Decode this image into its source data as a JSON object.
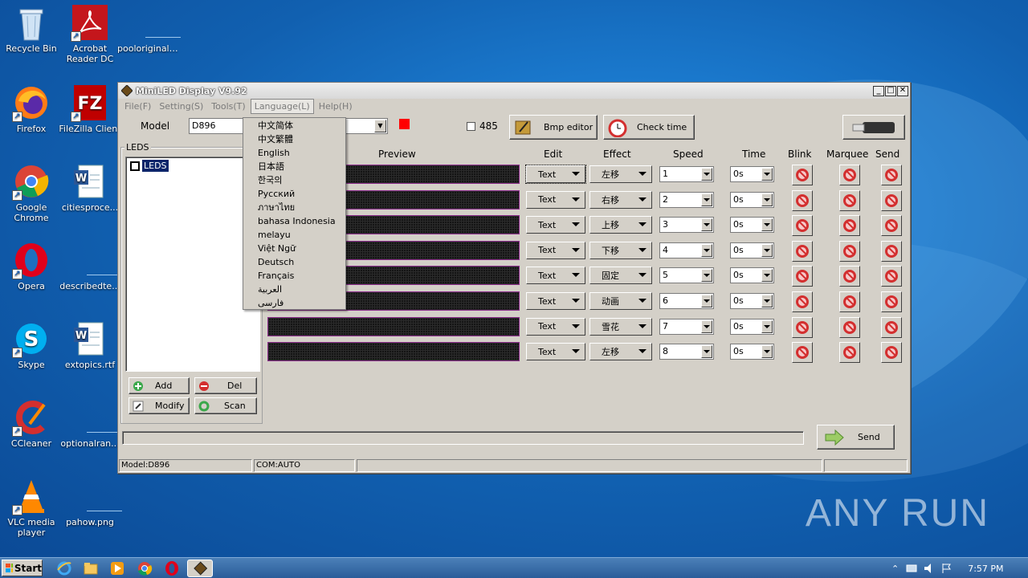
{
  "desktop": {
    "icons": [
      {
        "label": "Recycle Bin",
        "icon": "recycle-bin-icon"
      },
      {
        "label": "Acrobat Reader DC",
        "icon": "acrobat-icon"
      },
      {
        "label": "pooloriginal....",
        "icon": "file-icon"
      },
      {
        "label": "Firefox",
        "icon": "firefox-icon"
      },
      {
        "label": "FileZilla Client",
        "icon": "filezilla-icon"
      },
      {
        "label": "Google Chrome",
        "icon": "chrome-icon"
      },
      {
        "label": "citiesproce...",
        "icon": "word-doc-icon"
      },
      {
        "label": "Opera",
        "icon": "opera-icon"
      },
      {
        "label": "describedte...",
        "icon": "file-icon"
      },
      {
        "label": "Skype",
        "icon": "skype-icon"
      },
      {
        "label": "extopics.rtf",
        "icon": "word-doc-icon"
      },
      {
        "label": "CCleaner",
        "icon": "ccleaner-icon"
      },
      {
        "label": "optionalran...",
        "icon": "file-icon"
      },
      {
        "label": "VLC media player",
        "icon": "vlc-icon"
      },
      {
        "label": "pahow.png",
        "icon": "file-icon"
      }
    ],
    "watermark": "ANY RUN"
  },
  "window": {
    "title": "MiniLED Display V9.92",
    "menu": [
      "File(F)",
      "Setting(S)",
      "Tools(T)",
      "Language(L)",
      "Help(H)"
    ],
    "model_label": "Model",
    "model_value": "D896",
    "checkbox_485": "485",
    "bmp_editor": "Bmp editor",
    "check_time": "Check time",
    "leds_group": "LEDS",
    "leds_item": "LEDS",
    "buttons": {
      "add": "Add",
      "del": "Del",
      "modify": "Modify",
      "scan": "Scan",
      "send": "Send"
    },
    "headers": {
      "preview": "Preview",
      "edit": "Edit",
      "effect": "Effect",
      "speed": "Speed",
      "time": "Time",
      "blink": "Blink",
      "marquee": "Marquee",
      "send": "Send"
    },
    "rows": [
      {
        "edit": "Text",
        "effect": "左移",
        "speed": "1",
        "time": "0s"
      },
      {
        "edit": "Text",
        "effect": "右移",
        "speed": "2",
        "time": "0s"
      },
      {
        "edit": "Text",
        "effect": "上移",
        "speed": "3",
        "time": "0s"
      },
      {
        "edit": "Text",
        "effect": "下移",
        "speed": "4",
        "time": "0s"
      },
      {
        "edit": "Text",
        "effect": "固定",
        "speed": "5",
        "time": "0s"
      },
      {
        "edit": "Text",
        "effect": "动画",
        "speed": "6",
        "time": "0s"
      },
      {
        "edit": "Text",
        "effect": "雪花",
        "speed": "7",
        "time": "0s"
      },
      {
        "edit": "Text",
        "effect": "左移",
        "speed": "8",
        "time": "0s"
      }
    ],
    "language_menu": [
      "中文简体",
      "中文繁體",
      "English",
      "日本語",
      "한국의",
      "Русский",
      "ภาษาไทย",
      "bahasa Indonesia",
      "melayu",
      "Việt Ngữ",
      "Deutsch",
      "Français",
      "العربية",
      "فارسی"
    ],
    "status": {
      "model": "Model:D896",
      "com": "COM:AUTO"
    },
    "accent_color": "#ff0000"
  },
  "taskbar": {
    "start": "Start",
    "time": "7:57 PM"
  }
}
